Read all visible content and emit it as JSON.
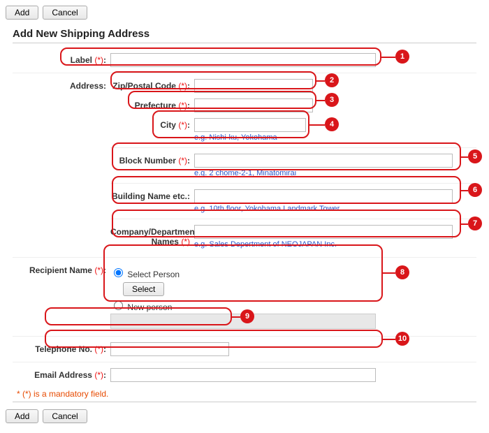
{
  "toolbar_top": {
    "add": "Add",
    "cancel": "Cancel"
  },
  "title": "Add New Shipping Address",
  "labels": {
    "label": "Label",
    "address": "Address",
    "zip": "Zip/Postal Code",
    "prefecture": "Prefecture",
    "city": "City",
    "block": "Block Number",
    "building": "Building Name etc.",
    "company": "Company/Department",
    "names": "Names",
    "recipient": "Recipient Name",
    "telephone": "Telephone No.",
    "email": "Email Address"
  },
  "req_marker": "(*)",
  "colon": ":",
  "hints": {
    "city": "e.g. Nishi-ku, Yokohama",
    "block": "e.g. 2 chome-2-1, Minatomirai",
    "building": "e.g. 10th floor, Yokohama Landmark Tower",
    "company": "e.g. Sales Depertment of NEOJAPAN Inc."
  },
  "recipient": {
    "select_person": "Select Person",
    "select_btn": "Select",
    "new_person": "New person"
  },
  "mandatory_note": "* (*) is a mandatory field.",
  "toolbar_bottom": {
    "add": "Add",
    "cancel": "Cancel"
  },
  "annotations": [
    "1",
    "2",
    "3",
    "4",
    "5",
    "6",
    "7",
    "8",
    "9",
    "10"
  ]
}
